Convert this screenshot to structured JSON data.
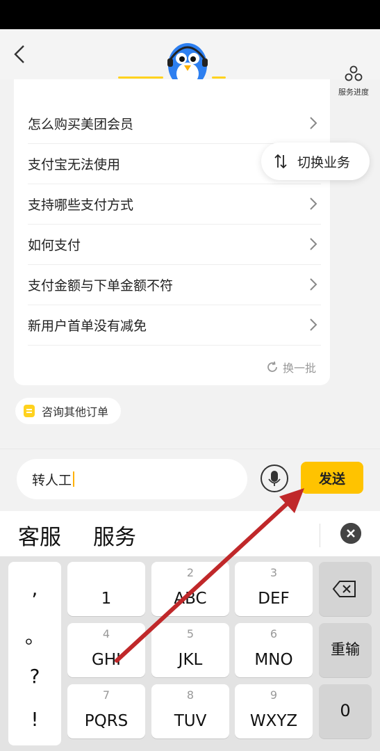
{
  "nav": {
    "progress_label": "服务进度"
  },
  "faq": {
    "items": [
      {
        "label": "怎么购买美团会员"
      },
      {
        "label": "支付宝无法使用"
      },
      {
        "label": "支持哪些支付方式"
      },
      {
        "label": "如何支付"
      },
      {
        "label": "支付金额与下单金额不符"
      },
      {
        "label": "新用户首单没有减免"
      }
    ],
    "refresh_label": "换一批"
  },
  "switch_business": {
    "label": "切换业务"
  },
  "other_order": {
    "label": "咨询其他订单"
  },
  "composer": {
    "input_value": "转人工",
    "send_label": "发送"
  },
  "candidates": [
    "客服",
    "服务"
  ],
  "keyboard": {
    "punct": [
      ",",
      "。",
      "?",
      "!"
    ],
    "keys": [
      {
        "digit": "",
        "letters": "1"
      },
      {
        "digit": "2",
        "letters": "ABC"
      },
      {
        "digit": "3",
        "letters": "DEF"
      },
      {
        "digit": "4",
        "letters": "GHI"
      },
      {
        "digit": "5",
        "letters": "JKL"
      },
      {
        "digit": "6",
        "letters": "MNO"
      },
      {
        "digit": "7",
        "letters": "PQRS"
      },
      {
        "digit": "8",
        "letters": "TUV"
      },
      {
        "digit": "9",
        "letters": "WXYZ"
      }
    ],
    "reenter_label": "重输",
    "zero_label": "0"
  },
  "colors": {
    "accent": "#ffc300",
    "arrow": "#c0282a"
  }
}
